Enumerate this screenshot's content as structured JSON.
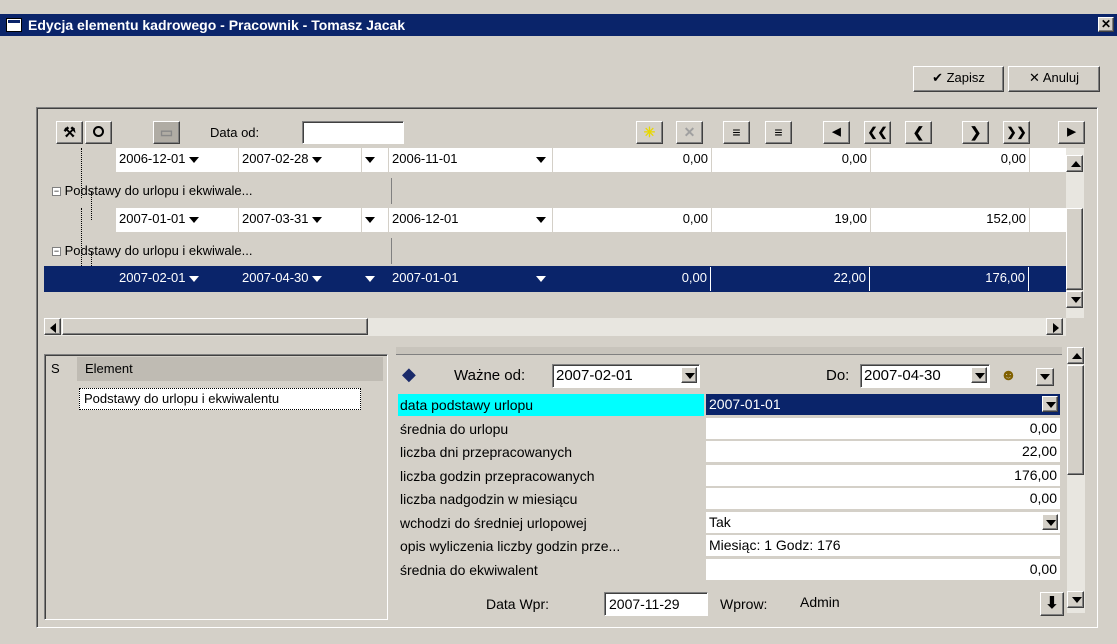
{
  "window": {
    "title": "Edycja elementu kadrowego - Pracownik - Tomasz Jacak",
    "close_glyph": "✕"
  },
  "actions": {
    "save_label": "Zapisz",
    "save_glyph": "✔",
    "cancel_label": "Anuluj",
    "cancel_glyph": "✕"
  },
  "toolbar": {
    "date_from_label": "Data od:",
    "date_from_value": "",
    "buttons": {
      "new": "✳",
      "delete": "✕",
      "insert": "≡",
      "remove": "≡",
      "prev": "◀",
      "first": "❮❮",
      "back": "❮",
      "next": "❯",
      "last": "❯❯",
      "end": "▶"
    }
  },
  "grid": {
    "group_label": "Podstawy do urlopu i ekwiwale...",
    "rows": [
      {
        "date_from": "2006-12-01",
        "date_to": "2007-02-28",
        "base_date": "2006-11-01",
        "v1": "0,00",
        "v2": "0,00",
        "v3": "0,00",
        "selected": false
      },
      {
        "date_from": "2007-01-01",
        "date_to": "2007-03-31",
        "base_date": "2006-12-01",
        "v1": "0,00",
        "v2": "19,00",
        "v3": "152,00",
        "selected": false
      },
      {
        "date_from": "2007-02-01",
        "date_to": "2007-04-30",
        "base_date": "2007-01-01",
        "v1": "0,00",
        "v2": "22,00",
        "v3": "176,00",
        "selected": true
      }
    ]
  },
  "elements": {
    "col_s": "S",
    "col_element": "Element",
    "items": [
      "Podstawy do urlopu i ekwiwalentu"
    ]
  },
  "details": {
    "valid_from_label": "Ważne od:",
    "valid_from_value": "2007-02-01",
    "valid_to_label": "Do:",
    "valid_to_value": "2007-04-30",
    "props": [
      {
        "label": "data podstawy urlopu",
        "value": "2007-01-01",
        "align": "left",
        "combo": true,
        "highlight": true
      },
      {
        "label": "średnia do urlopu",
        "value": "0,00",
        "align": "right",
        "combo": false,
        "highlight": false
      },
      {
        "label": "liczba dni przepracowanych",
        "value": "22,00",
        "align": "right",
        "combo": false,
        "highlight": false
      },
      {
        "label": "liczba godzin przepracowanych",
        "value": "176,00",
        "align": "right",
        "combo": false,
        "highlight": false
      },
      {
        "label": "liczba nadgodzin w miesiącu",
        "value": "0,00",
        "align": "right",
        "combo": false,
        "highlight": false
      },
      {
        "label": "wchodzi do średniej urlopowej",
        "value": "Tak",
        "align": "left",
        "combo": true,
        "highlight": false
      },
      {
        "label": "opis wyliczenia liczby godzin prze...",
        "value": "Miesiąc: 1 Godz: 176",
        "align": "left",
        "combo": false,
        "highlight": false
      },
      {
        "label": "średnia do ekwiwalent",
        "value": "0,00",
        "align": "right",
        "combo": false,
        "highlight": false
      }
    ],
    "entry_date_label": "Data Wpr:",
    "entry_date_value": "2007-11-29",
    "entered_by_label": "Wprow:",
    "entered_by_value": "Admin"
  },
  "colors": {
    "titlebar": "#0a246a",
    "selection": "#0a246a",
    "highlight_label": "#00ffff",
    "face": "#d4d0c8"
  }
}
